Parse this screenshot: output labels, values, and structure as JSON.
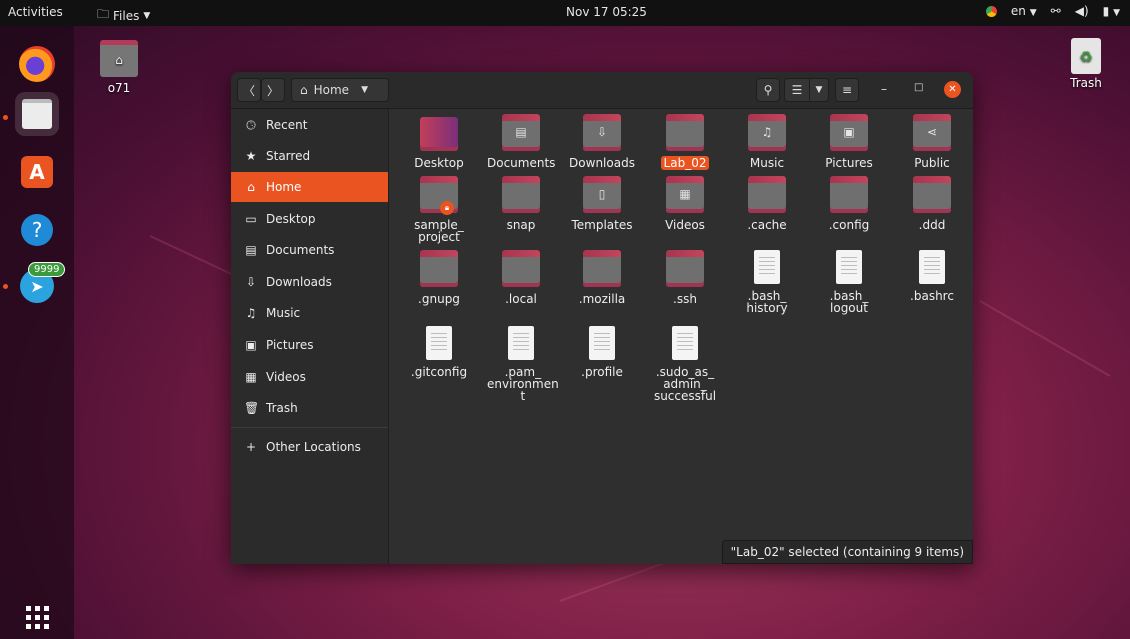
{
  "topbar": {
    "activities": "Activities",
    "app_menu": "Files",
    "clock": "Nov 17  05:25",
    "lang": "en"
  },
  "dock": {
    "badge_count": "9999",
    "items": [
      "firefox",
      "files",
      "software",
      "help",
      "telegram"
    ]
  },
  "desktop": {
    "home_label": "o71",
    "trash_label": "Trash"
  },
  "window": {
    "location": "Home",
    "status": "\"Lab_02\" selected  (containing 9 items)"
  },
  "sidebar": {
    "items": [
      {
        "label": "Recent",
        "icon": "clock-icon"
      },
      {
        "label": "Starred",
        "icon": "star-icon"
      },
      {
        "label": "Home",
        "icon": "home-icon"
      },
      {
        "label": "Desktop",
        "icon": "desktop-icon"
      },
      {
        "label": "Documents",
        "icon": "document-icon"
      },
      {
        "label": "Downloads",
        "icon": "download-icon"
      },
      {
        "label": "Music",
        "icon": "music-icon"
      },
      {
        "label": "Pictures",
        "icon": "picture-icon"
      },
      {
        "label": "Videos",
        "icon": "video-icon"
      },
      {
        "label": "Trash",
        "icon": "trash-icon"
      }
    ],
    "other_locations": "Other Locations"
  },
  "files": [
    {
      "name": "Desktop"
    },
    {
      "name": "Documents"
    },
    {
      "name": "Downloads"
    },
    {
      "name": "Lab_02"
    },
    {
      "name": "Music"
    },
    {
      "name": "Pictures"
    },
    {
      "name": "Public"
    },
    {
      "name": "sample_\nproject"
    },
    {
      "name": "snap"
    },
    {
      "name": "Templates"
    },
    {
      "name": "Videos"
    },
    {
      "name": ".cache"
    },
    {
      "name": ".config"
    },
    {
      "name": ".ddd"
    },
    {
      "name": ".gnupg"
    },
    {
      "name": ".local"
    },
    {
      "name": ".mozilla"
    },
    {
      "name": ".ssh"
    },
    {
      "name": ".bash_\nhistory"
    },
    {
      "name": ".bash_\nlogout"
    },
    {
      "name": ".bashrc"
    },
    {
      "name": ".gitconfig"
    },
    {
      "name": ".pam_\nenvironmen\nt"
    },
    {
      "name": ".profile"
    },
    {
      "name": ".sudo_as_\nadmin_\nsuccessful"
    }
  ]
}
